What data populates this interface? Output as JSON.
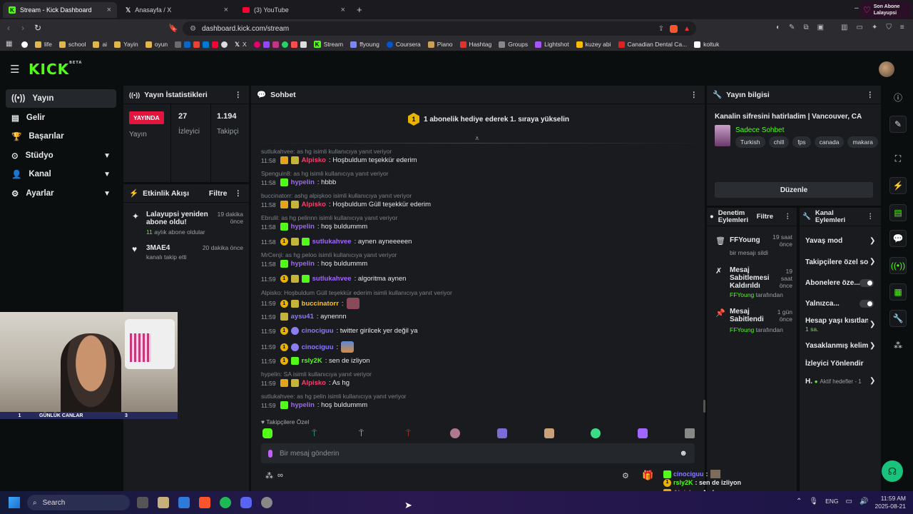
{
  "browser": {
    "tabs": [
      {
        "label": "Stream - Kick Dashboard",
        "close": "×"
      },
      {
        "label": "Anasayfa / X",
        "close": "×"
      },
      {
        "label": "(3) YouTube",
        "close": "×"
      }
    ],
    "new_tab": "+",
    "url": "dashboard.kick.com/stream",
    "notification": {
      "line1": "Son Abone",
      "line2": "Lalayupsi"
    },
    "bookmarks": [
      "life",
      "school",
      "ai",
      "Yayin",
      "oyun",
      "X",
      "Stream",
      "ffyoung",
      "Coursera",
      "Piano",
      "Hashtag",
      "Groups",
      "Lightshot",
      "kuzey abi",
      "Canadian Dental Ca...",
      "koltuk"
    ]
  },
  "kick": {
    "logo": "KICK",
    "beta": "BETA"
  },
  "sidebar": {
    "items": [
      {
        "label": "Yayın"
      },
      {
        "label": "Gelir"
      },
      {
        "label": "Başarılar"
      },
      {
        "label": "Stüdyo"
      },
      {
        "label": "Kanal"
      },
      {
        "label": "Ayarlar"
      }
    ]
  },
  "stats": {
    "title": "Yayın İstatistikleri",
    "live_badge": "YAYINDA",
    "live_label": "Yayın",
    "viewers": "27",
    "viewers_label": "İzleyici",
    "followers": "1.194",
    "followers_label": "Takipçi"
  },
  "activity": {
    "title": "Etkinlik Akışı",
    "filter": "Filtre",
    "events": [
      {
        "title": "Lalayupsi yeniden abone oldu!",
        "sub_num": "11",
        "sub": "aylık abone oldular",
        "time": "19 dakika önce"
      },
      {
        "title": "3MAE4",
        "sub": "kanalı takip etti",
        "time": "20 dakika önce"
      }
    ]
  },
  "chat": {
    "title": "Sohbet",
    "gift_number": "1",
    "gift_banner": "1 abonelik hediye ederek 1. sıraya yükselin",
    "input_placeholder": "Bir mesaj gönderin",
    "emote_label": "Takipçilere Özel",
    "messages": [
      {
        "reply": "sutlukahvee: as hg isimli kullanıcıya yanıt veriyor",
        "time": "11:58",
        "user": "Alpisko",
        "text": ": Hoşbuldum teşekkür ederim"
      },
      {
        "reply": "Spenguin8: as hg isimli kullanıcıya yanıt veriyor",
        "time": "11:58",
        "user": "hypelin",
        "text": ": hbbb"
      },
      {
        "reply": "buccinatorr: ashg alpişkoo isimli kullanıcıya yanıt veriyor",
        "time": "11:58",
        "user": "Alpisko",
        "text": ": Hoşbuldum Güll teşekkür ederim"
      },
      {
        "reply": "Ebrulil: as hg pelinnn isimli kullanıcıya yanıt veriyor",
        "time": "11:58",
        "user": "hypelin",
        "text": ": hoş buldummm"
      },
      {
        "reply": "",
        "time": "11:58",
        "user": "sutlukahvee",
        "text": ": aynen ayneeeeen"
      },
      {
        "reply": "MrCenji: as hg peloo isimli kullanıcıya yanıt veriyor",
        "time": "11:58",
        "user": "hypelin",
        "text": ": hoş buldummm"
      },
      {
        "reply": "",
        "time": "11:59",
        "user": "sutlukahvee",
        "text": ": algoritma aynen"
      },
      {
        "reply": "Alpisko: Hoşbuldum Güll teşekkür ederim isimli kullanıcıya yanıt veriyor",
        "time": "11:59",
        "user": "buccinatorr",
        "text": ":"
      },
      {
        "reply": "",
        "time": "11:59",
        "user": "aysu41",
        "text": ": aynennn"
      },
      {
        "reply": "",
        "time": "11:59",
        "user": "cinociguu",
        "text": ": twitter girilcek yer değil ya"
      },
      {
        "reply": "",
        "time": "11:59",
        "user": "cinociguu",
        "text": ":"
      },
      {
        "reply": "",
        "time": "11:59",
        "user": "rsly2K",
        "text": ": sen de izliyon"
      },
      {
        "reply": "hypelin: SA isimli kullanıcıya yanıt veriyor",
        "time": "11:59",
        "user": "Alpisko",
        "text": ": As hg"
      },
      {
        "reply": "sutlukahvee: as hg pelin isimli kullanıcıya yanıt veriyor",
        "time": "11:59",
        "user": "hypelin",
        "text": ": hoş buldummm"
      }
    ]
  },
  "stream_info": {
    "title": "Yayın bilgisi",
    "stream_title": "Kanalin sifresini hatirladim | Vancouver, CA",
    "category": "Sadece Sohbet",
    "tags": [
      "Turkish",
      "chill",
      "fps",
      "canada",
      "makara"
    ],
    "edit_button": "Düzenle"
  },
  "mod_actions": {
    "title": "Denetim Eylemleri",
    "filter": "Filtre",
    "items": [
      {
        "title": "FFYoung",
        "sub": "bir mesajı sildi",
        "time": "19 saat önce"
      },
      {
        "title": "Mesaj Sabitlemesi Kaldırıldı",
        "by": "FFYoung",
        "by_suffix": "tarafından",
        "time": "19 saat önce"
      },
      {
        "title": "Mesaj Sabitlendi",
        "by": "FFYoung",
        "by_suffix": "tarafından",
        "time": "1 gün önce"
      }
    ]
  },
  "channel_actions": {
    "title": "Kanal Eylemleri",
    "items": [
      {
        "label": "Yavaş mod"
      },
      {
        "label": "Takipçilere özel so"
      },
      {
        "label": "Abonelere öze..."
      },
      {
        "label": "Yalnızca..."
      },
      {
        "label": "Hesap yaşı kısıtlan",
        "sub": "1 sa."
      },
      {
        "label": "Yasaklanmış kelim"
      },
      {
        "label": "İzleyici Yönlendir"
      },
      {
        "label": "H.",
        "sub": "Aktif hedefler - 1"
      }
    ]
  },
  "webcam": {
    "overlay_left": "1",
    "overlay_mid": "GÜNLÜK CANLAR",
    "overlay_right": "3"
  },
  "overlay_chat": [
    {
      "user": "cinociguu",
      "text": ":"
    },
    {
      "user": "rsly2K",
      "text": ": sen de izliyon"
    },
    {
      "user": "Alpisko",
      "text": ": As hg"
    }
  ],
  "taskbar": {
    "search": "Search",
    "lang": "ENG",
    "time": "11:59 AM",
    "date": "2025-08-21"
  },
  "colors": {
    "kick_green": "#53fc18",
    "panel": "#191b1f",
    "background": "#0b0e0f"
  }
}
